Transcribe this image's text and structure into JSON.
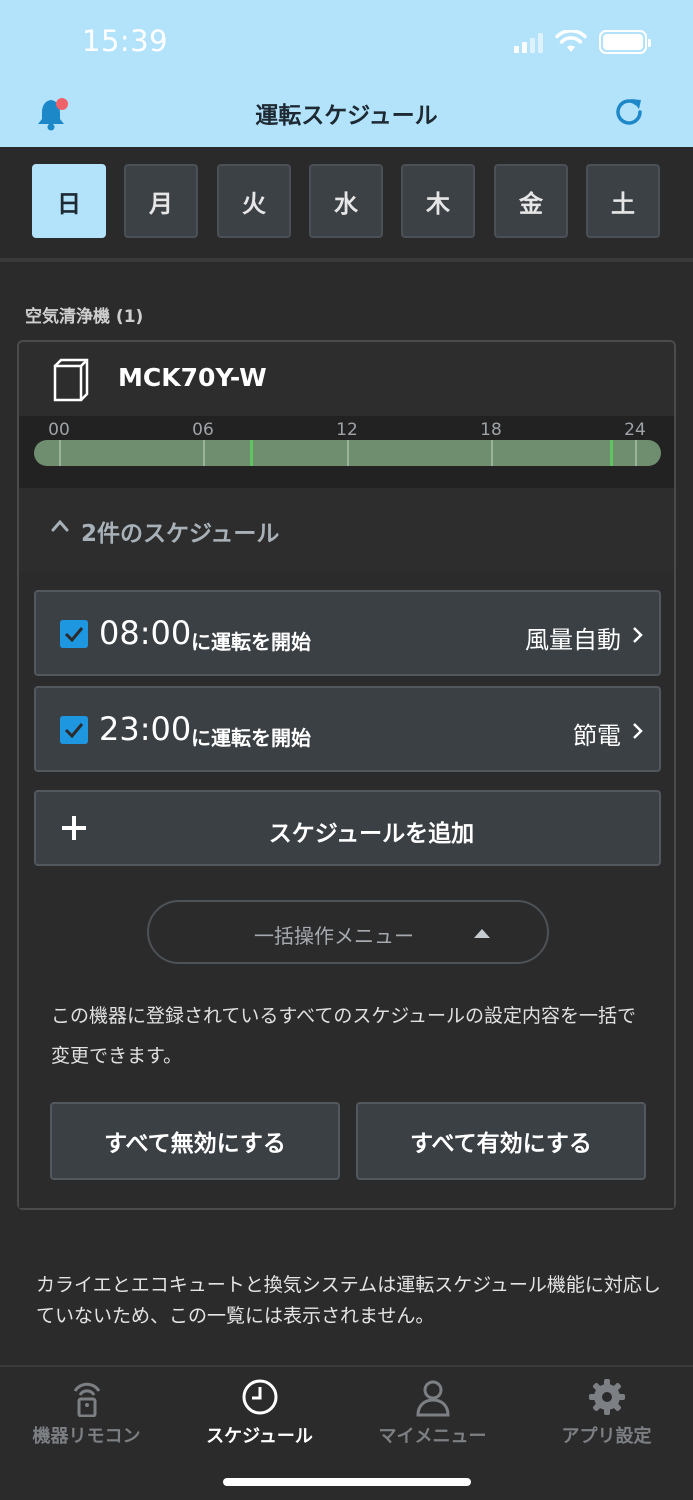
{
  "status_bar": {
    "time": "15:39"
  },
  "header": {
    "title": "運転スケジュール"
  },
  "days": [
    {
      "label": "日",
      "active": true
    },
    {
      "label": "月",
      "active": false
    },
    {
      "label": "火",
      "active": false
    },
    {
      "label": "水",
      "active": false
    },
    {
      "label": "木",
      "active": false
    },
    {
      "label": "金",
      "active": false
    },
    {
      "label": "土",
      "active": false
    }
  ],
  "section": {
    "label": "空気清浄機 (1)"
  },
  "device": {
    "name": "MCK70Y-W",
    "timeline_labels": [
      "00",
      "06",
      "12",
      "18",
      "24"
    ],
    "scheduled_hours": [
      8,
      23
    ]
  },
  "schedule_toggle": {
    "label": "2件のスケジュール"
  },
  "schedules": [
    {
      "time": "08:00",
      "suffix": "に運転を開始",
      "mode": "風量自動",
      "checked": true
    },
    {
      "time": "23:00",
      "suffix": "に運転を開始",
      "mode": "節電",
      "checked": true
    }
  ],
  "add_button": {
    "label": "スケジュールを追加"
  },
  "bulk_menu": {
    "label": "一括操作メニュー"
  },
  "bulk_description": "この機器に登録されているすべてのスケジュールの設定内容を一括で変更できます。",
  "bulk_buttons": {
    "disable_all": "すべて無効にする",
    "enable_all": "すべて有効にする"
  },
  "footnote": "カライエとエコキュートと換気システムは運転スケジュール機能に対応していないため、この一覧には表示されません。",
  "bottom_nav": [
    {
      "label": "機器リモコン",
      "icon": "remote-icon",
      "active": false
    },
    {
      "label": "スケジュール",
      "icon": "clock-icon",
      "active": true
    },
    {
      "label": "マイメニュー",
      "icon": "person-icon",
      "active": false
    },
    {
      "label": "アプリ設定",
      "icon": "gear-icon",
      "active": false
    }
  ],
  "colors": {
    "header_bg": "#b3e3fb",
    "accent_green": "#5ec55e",
    "checkbox_blue": "#1e96e0",
    "notification_dot": "#f0626a"
  }
}
